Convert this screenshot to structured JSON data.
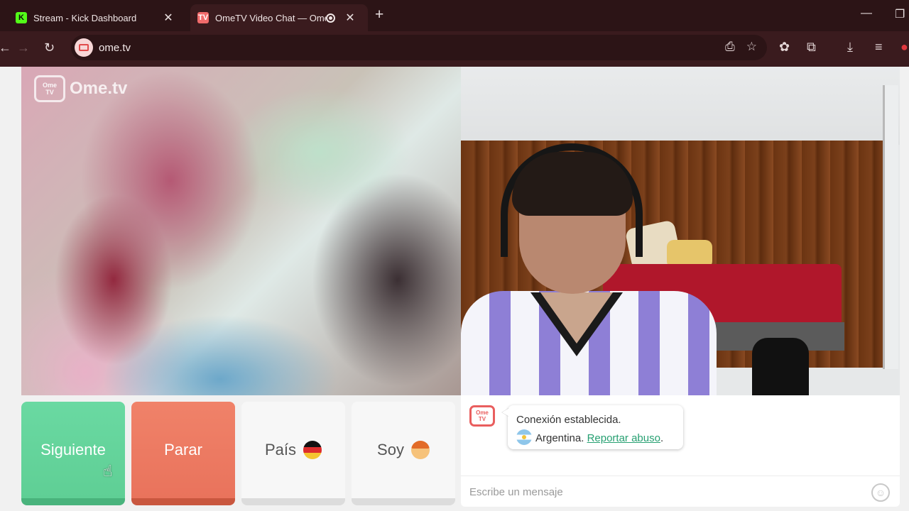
{
  "browser": {
    "tabs": [
      {
        "title": "Stream - Kick Dashboard",
        "favicon": "kick-logo-icon",
        "active": false
      },
      {
        "title": "OmeTV Video Chat — Ome",
        "favicon": "ometv-logo-icon",
        "active": true
      }
    ],
    "url": "ome.tv"
  },
  "logo": {
    "tv_text_1": "Ome",
    "tv_text_2": "TV",
    "wordmark": "Ome.tv"
  },
  "buttons": {
    "next": "Siguiente",
    "stop": "Parar",
    "country": "País",
    "country_flag": "germany-flag-icon",
    "gender": "Soy",
    "gender_icon": "boy-icon"
  },
  "chat": {
    "status": "Conexión establecida.",
    "country": "Argentina.",
    "report_link": "Reportar abuso",
    "report_suffix": ".",
    "input_placeholder": "Escribe un mensaje"
  },
  "colors": {
    "next_button": "#5fcf95",
    "stop_button": "#e9735c",
    "report_link": "#27a072",
    "chrome_bg": "#3a1b1e"
  }
}
